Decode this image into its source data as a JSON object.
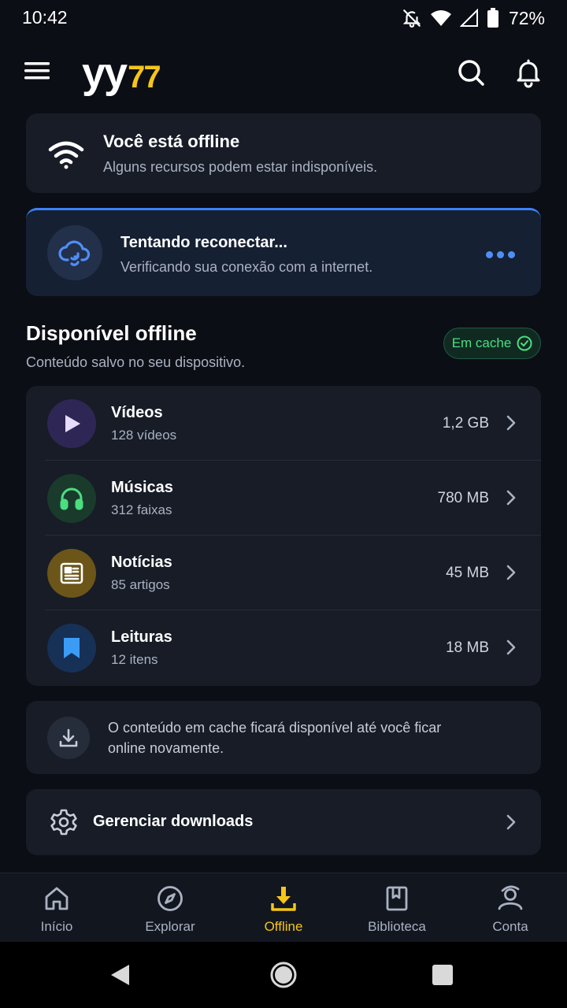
{
  "status_bar": {
    "time": "10:42",
    "battery": "72%"
  },
  "header": {
    "logo_main": "yy",
    "logo_accent": "77"
  },
  "offline_banner": {
    "title": "Você está offline",
    "subtitle": "Alguns recursos podem estar indisponíveis."
  },
  "reconnect_banner": {
    "title": "Tentando reconectar...",
    "subtitle": "Verificando sua conexão com a internet."
  },
  "offline_section": {
    "title": "Disponível offline",
    "subtitle": "Conteúdo salvo no seu dispositivo.",
    "badge": "Em cache",
    "items": [
      {
        "title": "Vídeos",
        "subtitle": "128 vídeos",
        "size": "1,2 GB",
        "icon": "play-icon",
        "color": "#a78bfa",
        "bg": "#2e2654"
      },
      {
        "title": "Músicas",
        "subtitle": "312 faixas",
        "size": "780 MB",
        "icon": "headphones-icon",
        "color": "#4ade80",
        "bg": "#1a3b2c"
      },
      {
        "title": "Notícias",
        "subtitle": "85 artigos",
        "size": "45 MB",
        "icon": "newspaper-icon",
        "color": "#ffffff",
        "bg": "#6b5518"
      },
      {
        "title": "Leituras",
        "subtitle": "12 itens",
        "size": "18 MB",
        "icon": "bookmark-icon",
        "color": "#3b9cf6",
        "bg": "#173056"
      }
    ]
  },
  "info_card": {
    "text": "O conteúdo em cache ficará disponível até você ficar online novamente."
  },
  "manage": {
    "label": "Gerenciar downloads"
  },
  "bottom_nav": {
    "items": [
      {
        "label": "Início",
        "icon": "home-icon"
      },
      {
        "label": "Explorar",
        "icon": "compass-icon"
      },
      {
        "label": "Offline",
        "icon": "download-icon",
        "active": true
      },
      {
        "label": "Biblioteca",
        "icon": "library-icon"
      },
      {
        "label": "Conta",
        "icon": "account-icon"
      }
    ]
  },
  "colors": {
    "accent": "#f5c518",
    "background": "#0b0e14",
    "card": "#171c27",
    "link_blue": "#3b82f6",
    "success": "#4ade80"
  }
}
